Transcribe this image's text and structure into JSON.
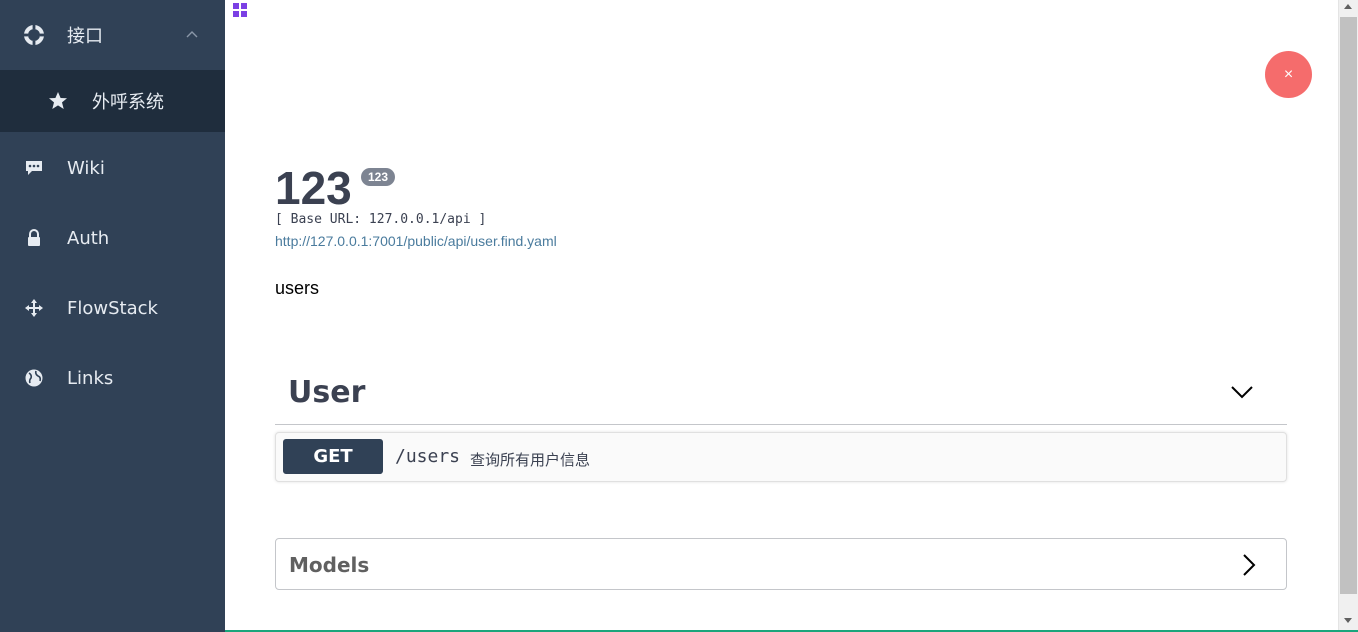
{
  "sidebar": {
    "items": [
      {
        "label": "接口",
        "icon": "lifebuoy-icon",
        "expanded": true
      },
      {
        "label": "外呼系统",
        "icon": "star-icon",
        "active": true
      },
      {
        "label": "Wiki",
        "icon": "comment-icon"
      },
      {
        "label": "Auth",
        "icon": "lock-icon"
      },
      {
        "label": "FlowStack",
        "icon": "move-icon"
      },
      {
        "label": "Links",
        "icon": "globe-icon"
      }
    ]
  },
  "main": {
    "close_label": "×",
    "title": "123",
    "version": "123",
    "base_url": "[ Base URL: 127.0.0.1/api ]",
    "spec_url": "http://127.0.0.1:7001/public/api/user.find.yaml",
    "description": "users",
    "tag": {
      "name": "User"
    },
    "operation": {
      "method": "GET",
      "path": "/users",
      "summary": "查询所有用户信息"
    },
    "models_label": "Models"
  },
  "colors": {
    "sidebar_bg": "#304156",
    "submenu_bg": "#1f2d3d",
    "close_button": "#f56c6c",
    "method_badge": "#304156",
    "grid_icon": "#7b3fe4",
    "link": "#4a7b9d"
  }
}
